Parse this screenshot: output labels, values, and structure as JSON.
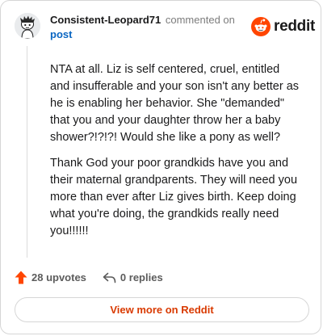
{
  "comment": {
    "author": "Consistent-Leopard71",
    "meta_text": "commented on",
    "post_link": "post",
    "paragraphs": [
      "NTA at all. Liz is self centered, cruel, entitled and insufferable and your son isn't any better as he is enabling her behavior. She \"demanded\" that you and your daughter throw her a baby shower?!?!?! Would she like a pony as well?",
      "Thank God your poor grandkids have you and their maternal grandparents. They will need you more than ever after Liz gives birth. Keep doing what you're doing, the grandkids really need you!!!!!!"
    ]
  },
  "brand": {
    "wordmark": "reddit",
    "icon": "reddit-snoo-icon",
    "color": "#ff4500"
  },
  "actions": {
    "upvotes_label": "28 upvotes",
    "upvote_icon": "upvote-arrow-icon",
    "upvote_color": "#ff4500",
    "replies_label": "0 replies",
    "reply_icon": "reply-arrow-icon"
  },
  "footer": {
    "view_more_label": "View more on Reddit",
    "accent": "#d93a00"
  },
  "avatar": {
    "icon": "user-avatar-icon"
  }
}
